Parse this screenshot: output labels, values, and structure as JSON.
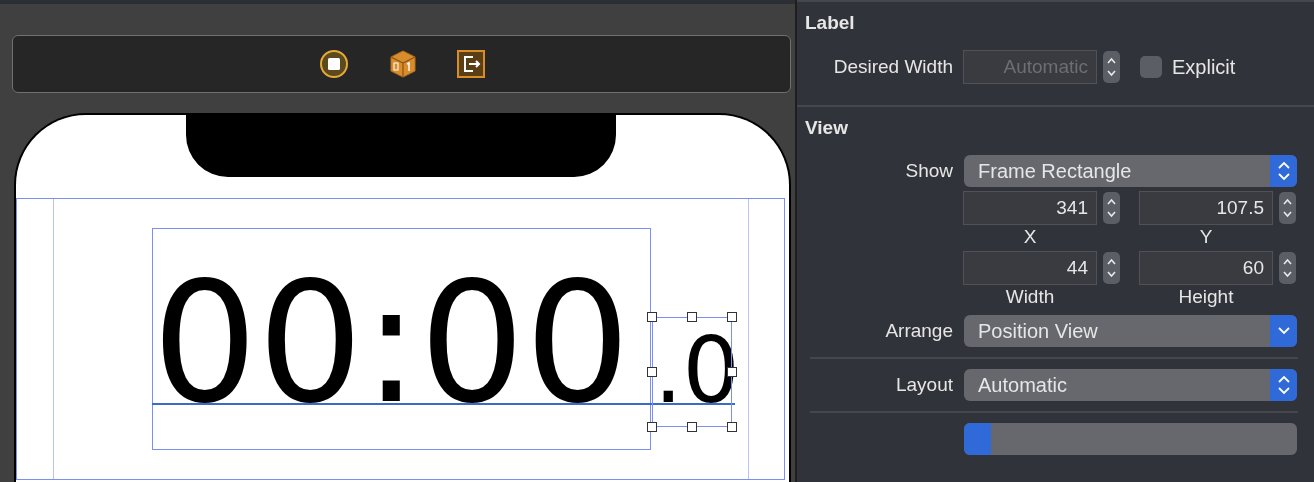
{
  "canvas": {
    "time_label": "00:00",
    "tenths_label": ".0",
    "tenths_selected": true
  },
  "label_section": {
    "title": "Label",
    "desired_width": {
      "label": "Desired Width",
      "placeholder": "Automatic",
      "disabled": true
    },
    "explicit": {
      "label": "Explicit",
      "checked": false
    }
  },
  "view_section": {
    "title": "View",
    "show": {
      "label": "Show",
      "value": "Frame Rectangle",
      "kind": "popup"
    },
    "fields": [
      {
        "value": "341",
        "caption": "X"
      },
      {
        "value": "107.5",
        "caption": "Y"
      },
      {
        "value": "44",
        "caption": "Width"
      },
      {
        "value": "60",
        "caption": "Height"
      }
    ],
    "menus": [
      {
        "label": "Arrange",
        "value": "Position View",
        "kind": "pulldown"
      },
      {
        "label": "Layout",
        "value": "Automatic",
        "kind": "popup"
      }
    ]
  }
}
